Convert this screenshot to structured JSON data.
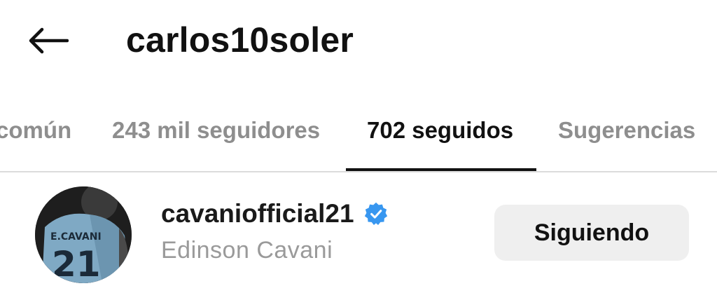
{
  "header": {
    "title": "carlos10soler",
    "back_icon": "arrow-left-icon"
  },
  "tabs": [
    {
      "label": "común",
      "active": false
    },
    {
      "label": "243 mil seguidores",
      "active": false
    },
    {
      "label": "702 seguidos",
      "active": true
    },
    {
      "label": "Sugerencias",
      "active": false
    }
  ],
  "user": {
    "username": "cavaniofficial21",
    "full_name": "Edinson Cavani",
    "verified": true,
    "verified_icon": "verified-badge-icon",
    "avatar_jersey_name": "E.CAVANI",
    "avatar_jersey_number": "21",
    "button_label": "Siguiendo"
  },
  "colors": {
    "primary_text": "#111111",
    "secondary_text": "#8e8e8e",
    "verified_blue": "#3897f0",
    "button_bg": "#efefef",
    "divider": "#dbdbdb"
  }
}
